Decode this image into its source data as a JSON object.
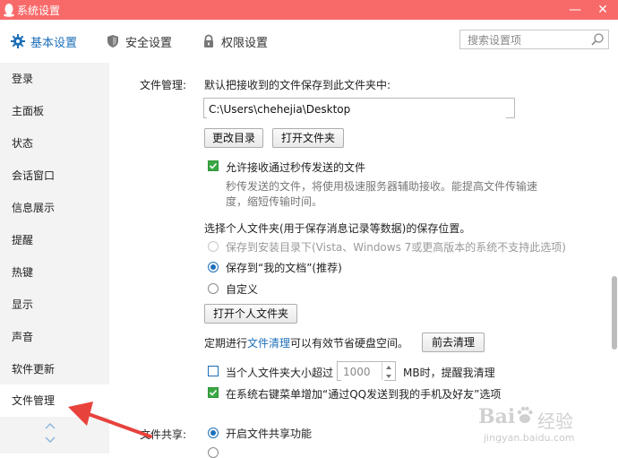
{
  "window": {
    "title": "系统设置",
    "accent": "#f86a6a",
    "controls": {
      "minimize": "—",
      "close": "✕"
    }
  },
  "topnav": {
    "tabs": [
      {
        "label": "基本设置",
        "icon": "gear-icon",
        "active": true
      },
      {
        "label": "安全设置",
        "icon": "shield-icon",
        "active": false
      },
      {
        "label": "权限设置",
        "icon": "lock-icon",
        "active": false
      }
    ],
    "search_placeholder": "搜索设置项"
  },
  "sidebar": {
    "items": [
      {
        "label": "登录"
      },
      {
        "label": "主面板"
      },
      {
        "label": "状态"
      },
      {
        "label": "会话窗口"
      },
      {
        "label": "信息展示"
      },
      {
        "label": "提醒"
      },
      {
        "label": "热键"
      },
      {
        "label": "显示"
      },
      {
        "label": "声音"
      },
      {
        "label": "软件更新"
      },
      {
        "label": "文件管理",
        "active": true
      }
    ]
  },
  "file_mgmt": {
    "section_label": "文件管理:",
    "save_desc": "默认把接收到的文件保存到此文件夹中:",
    "path": "C:\\Users\\chehejia\\Desktop",
    "change_dir_button": "更改目录",
    "open_folder_button": "打开文件夹",
    "allow_fast_transfer": {
      "label": "允许接收通过秒传发送的文件",
      "checked": true,
      "desc_line1": "秒传发送的文件，将使用极速服务器辅助接收。能提高文件传输速",
      "desc_line2": "度，缩短传输时间。"
    },
    "personal_folder_title": "选择个人文件夹(用于保存消息记录等数据)的保存位置。",
    "radios": [
      {
        "label": "保存到安装目录下(Vista、Windows 7或更高版本的系统不支持此选项)",
        "disabled": true,
        "selected": false
      },
      {
        "label": "保存到“我的文档”(推荐)",
        "disabled": false,
        "selected": true
      },
      {
        "label": "自定义",
        "disabled": false,
        "selected": false
      }
    ],
    "open_personal_folder_button": "打开个人文件夹",
    "cleanup_prefix": "定期进行",
    "cleanup_link": "文件清理",
    "cleanup_suffix": "可以有效节省硬盘空间。",
    "cleanup_button": "前去清理",
    "size_limit": {
      "label_before": "当个人文件夹大小超过",
      "value": "1000",
      "label_after": "MB时，提醒我清理",
      "checked": false
    },
    "context_menu": {
      "label": "在系统右键菜单增加“通过QQ发送到我的手机及好友”选项",
      "checked": true
    }
  },
  "file_share": {
    "section_label": "文件共享:",
    "enable_label": "开启文件共享功能",
    "selected": true
  },
  "watermark": {
    "brand": "Bai",
    "brand2": "经验",
    "url": "jingyan.baidu.com"
  },
  "annotation_color": "#e8423c"
}
